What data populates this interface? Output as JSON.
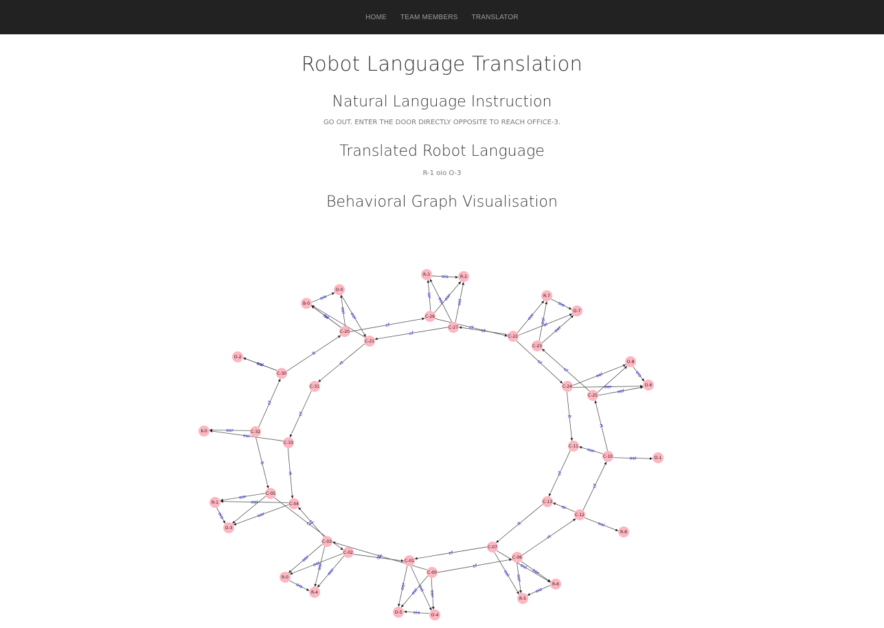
{
  "nav": {
    "items": [
      {
        "label": "HOME"
      },
      {
        "label": "TEAM MEMBERS"
      },
      {
        "label": "TRANSLATOR"
      }
    ]
  },
  "page": {
    "title": "Robot Language Translation",
    "section_instruction_title": "Natural Language Instruction",
    "instruction_text": "GO OUT. ENTER THE DOOR DIRECTLY OPPOSITE TO REACH OFFICE-3.",
    "section_translation_title": "Translated Robot Language",
    "translation_text": "R-1 oio O-3",
    "section_graph_title": "Behavioral Graph Visualisation"
  },
  "colors": {
    "navbar_bg": "#222222",
    "nav_text": "#9d9d9d",
    "node_fill": "#ffb6c1",
    "edge_label": "#1a1ad6"
  },
  "graph": {
    "nodes": [
      {
        "id": "O-0"
      },
      {
        "id": "B-0"
      },
      {
        "id": "C-20"
      },
      {
        "id": "C-21"
      },
      {
        "id": "R-3"
      },
      {
        "id": "R-2"
      },
      {
        "id": "C-26"
      },
      {
        "id": "C-27"
      },
      {
        "id": "R-7"
      },
      {
        "id": "O-7"
      },
      {
        "id": "C-22"
      },
      {
        "id": "C-23"
      },
      {
        "id": "O-2"
      },
      {
        "id": "C-30"
      },
      {
        "id": "C-31"
      },
      {
        "id": "O-8"
      },
      {
        "id": "O-6"
      },
      {
        "id": "C-24"
      },
      {
        "id": "C-25"
      },
      {
        "id": "K-0"
      },
      {
        "id": "C-32"
      },
      {
        "id": "C-33"
      },
      {
        "id": "C-11"
      },
      {
        "id": "C-10"
      },
      {
        "id": "O-1"
      },
      {
        "id": "R-1"
      },
      {
        "id": "C-05"
      },
      {
        "id": "C-04"
      },
      {
        "id": "O-3"
      },
      {
        "id": "C-13"
      },
      {
        "id": "C-12"
      },
      {
        "id": "R-8"
      },
      {
        "id": "C-03"
      },
      {
        "id": "C-02"
      },
      {
        "id": "C-07"
      },
      {
        "id": "C-06"
      },
      {
        "id": "C-01"
      },
      {
        "id": "C-00"
      },
      {
        "id": "R-0"
      },
      {
        "id": "R-4"
      },
      {
        "id": "R-6"
      },
      {
        "id": "R-5"
      },
      {
        "id": "O-5"
      },
      {
        "id": "O-4"
      }
    ],
    "edges": [
      {
        "from": "B-0",
        "to": "O-0",
        "label": "oio"
      },
      {
        "from": "C-20",
        "to": "O-0",
        "label": "ool"
      },
      {
        "from": "O-0",
        "to": "C-21",
        "label": "oor"
      },
      {
        "from": "C-20",
        "to": "B-0",
        "label": "iol"
      },
      {
        "from": "C-20",
        "to": "B-0",
        "label": "ior"
      },
      {
        "from": "C-21",
        "to": "B-0",
        "label": ""
      },
      {
        "from": "C-20",
        "to": "C-26",
        "label": "cf"
      },
      {
        "from": "C-27",
        "to": "C-21",
        "label": "cf"
      },
      {
        "from": "R-3",
        "to": "R-2",
        "label": "oio"
      },
      {
        "from": "C-26",
        "to": "R-3",
        "label": "ior"
      },
      {
        "from": "C-27",
        "to": "R-3",
        "label": "ool"
      },
      {
        "from": "C-26",
        "to": "R-2",
        "label": "oor"
      },
      {
        "from": "C-27",
        "to": "R-2",
        "label": "ool"
      },
      {
        "from": "C-26",
        "to": "C-22",
        "label": "cf"
      },
      {
        "from": "C-22",
        "to": "C-27",
        "label": "cf"
      },
      {
        "from": "R-7",
        "to": "O-7",
        "label": "oio"
      },
      {
        "from": "C-22",
        "to": "R-7",
        "label": "oor"
      },
      {
        "from": "C-23",
        "to": "R-7",
        "label": "ool"
      },
      {
        "from": "C-22",
        "to": "O-7",
        "label": "ol"
      },
      {
        "from": "C-23",
        "to": "O-7",
        "label": "oor"
      },
      {
        "from": "C-22",
        "to": "C-24",
        "label": "cf"
      },
      {
        "from": "C-25",
        "to": "C-23",
        "label": "cf"
      },
      {
        "from": "C-30",
        "to": "O-2",
        "label": "oor"
      },
      {
        "from": "C-30",
        "to": "O-2",
        "label": "ool"
      },
      {
        "from": "C-30",
        "to": "C-20",
        "label": "lt"
      },
      {
        "from": "C-21",
        "to": "C-31",
        "label": "rt"
      },
      {
        "from": "C-32",
        "to": "C-30",
        "label": "cf"
      },
      {
        "from": "C-31",
        "to": "C-33",
        "label": "cf"
      },
      {
        "from": "O-8",
        "to": "O-6",
        "label": "oio"
      },
      {
        "from": "C-24",
        "to": "O-8",
        "label": "ool"
      },
      {
        "from": "C-25",
        "to": "O-8",
        "label": ""
      },
      {
        "from": "C-24",
        "to": "O-6",
        "label": "oor"
      },
      {
        "from": "C-25",
        "to": "O-6",
        "label": "ool"
      },
      {
        "from": "C-24",
        "to": "C-11",
        "label": "lt"
      },
      {
        "from": "C-10",
        "to": "C-25",
        "label": "rt"
      },
      {
        "from": "C-32",
        "to": "K-0",
        "label": "oor"
      },
      {
        "from": "C-33",
        "to": "K-0",
        "label": "ool"
      },
      {
        "from": "C-32",
        "to": "C-05",
        "label": "lt"
      },
      {
        "from": "C-33",
        "to": "C-04",
        "label": "rt"
      },
      {
        "from": "C-10",
        "to": "C-11",
        "label": "oor"
      },
      {
        "from": "C-10",
        "to": "O-1",
        "label": "ool"
      },
      {
        "from": "C-11",
        "to": "C-13",
        "label": "cf"
      },
      {
        "from": "C-12",
        "to": "C-10",
        "label": "cf"
      },
      {
        "from": "C-05",
        "to": "R-1",
        "label": "oor"
      },
      {
        "from": "C-04",
        "to": "R-1",
        "label": "ool"
      },
      {
        "from": "R-1",
        "to": "O-3",
        "label": "oio"
      },
      {
        "from": "C-05",
        "to": "O-3",
        "label": ""
      },
      {
        "from": "C-04",
        "to": "O-3",
        "label": "oor"
      },
      {
        "from": "C-05",
        "to": "C-02",
        "label": "cf"
      },
      {
        "from": "C-03",
        "to": "C-04",
        "label": "cf"
      },
      {
        "from": "C-13",
        "to": "C-07",
        "label": "lt"
      },
      {
        "from": "C-06",
        "to": "C-12",
        "label": "rt"
      },
      {
        "from": "C-12",
        "to": "C-13",
        "label": "or"
      },
      {
        "from": "C-12",
        "to": "R-8",
        "label": "ool"
      },
      {
        "from": "C-03",
        "to": "R-0",
        "label": "oor"
      },
      {
        "from": "C-02",
        "to": "R-0",
        "label": "ool"
      },
      {
        "from": "C-03",
        "to": "R-4",
        "label": "ool"
      },
      {
        "from": "C-02",
        "to": "R-4",
        "label": "oor"
      },
      {
        "from": "R-0",
        "to": "R-4",
        "label": "oio"
      },
      {
        "from": "C-02",
        "to": "C-01",
        "label": "cf"
      },
      {
        "from": "C-00",
        "to": "C-03",
        "label": "cf"
      },
      {
        "from": "C-07",
        "to": "C-01",
        "label": "cf"
      },
      {
        "from": "C-00",
        "to": "C-06",
        "label": "cf"
      },
      {
        "from": "C-06",
        "to": "R-6",
        "label": "oor"
      },
      {
        "from": "C-07",
        "to": "R-6",
        "label": "ool"
      },
      {
        "from": "C-06",
        "to": "R-5",
        "label": "oor"
      },
      {
        "from": "C-07",
        "to": "R-5",
        "label": "ool"
      },
      {
        "from": "R-6",
        "to": "R-5",
        "label": "oio"
      },
      {
        "from": "C-01",
        "to": "O-5",
        "label": "oor"
      },
      {
        "from": "C-00",
        "to": "O-5",
        "label": "ool"
      },
      {
        "from": "C-01",
        "to": "O-4",
        "label": "ool"
      },
      {
        "from": "C-00",
        "to": "O-4",
        "label": "oor"
      },
      {
        "from": "O-4",
        "to": "O-5",
        "label": "oio"
      }
    ]
  }
}
